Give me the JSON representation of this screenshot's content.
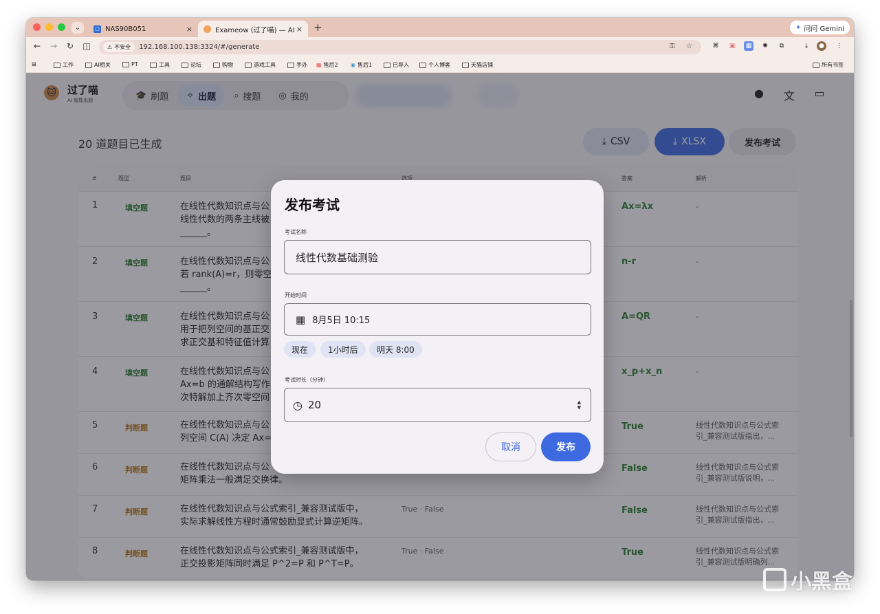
{
  "browser": {
    "tabs": [
      {
        "title": "NAS90B051",
        "close": "×"
      },
      {
        "title": "Exameow (过了喵) — AI Exam",
        "close": "×"
      }
    ],
    "new_tab": "+",
    "gemini_label": "问问 Gemini",
    "insecure_label": "不安全",
    "url": "192.168.100.138:3324/#/generate",
    "bookmarks": [
      "工作",
      "AI相关",
      "PT",
      "工具",
      "论坛",
      "购物",
      "游戏工具",
      "手办",
      "售后2",
      "售后1",
      "已导入",
      "个人博客",
      "天猫店铺"
    ],
    "all_bookmarks": "所有书签"
  },
  "app": {
    "brand_title": "过了喵",
    "brand_subtitle": "AI 智能出题",
    "nav": [
      {
        "icon": "graduation-icon",
        "label": "刷题"
      },
      {
        "icon": "sparkle-icon",
        "label": "出题"
      },
      {
        "icon": "search-icon",
        "label": "搜题"
      },
      {
        "icon": "user-icon",
        "label": "我的"
      }
    ],
    "summary": "20 道题目已生成",
    "btn_csv": "CSV",
    "btn_xlsx": "XLSX",
    "btn_publish": "发布考试"
  },
  "table": {
    "headers": [
      "#",
      "题型",
      "题目",
      "选项",
      "答案",
      "解析"
    ],
    "rows": [
      {
        "num": "1",
        "type": "填空题",
        "kind": "fill",
        "q1": "在线性代数知识点与公",
        "q2": "线性代数的两条主线被",
        "q3": "______。",
        "opt": "",
        "ans": "Ax=λx",
        "exp1": "-",
        "exp2": ""
      },
      {
        "num": "2",
        "type": "填空题",
        "kind": "fill",
        "q1": "在线性代数知识点与公",
        "q2": "若 rank(A)=r，则零空间",
        "q3": "______。",
        "opt": "",
        "ans": "n-r",
        "exp1": "-",
        "exp2": ""
      },
      {
        "num": "3",
        "type": "填空题",
        "kind": "fill",
        "q1": "在线性代数知识点与公",
        "q2": "用于把列空间的基正交",
        "q3": "求正交基和特征值计算",
        "opt": "",
        "ans": "A=QR",
        "exp1": "-",
        "exp2": ""
      },
      {
        "num": "4",
        "type": "填空题",
        "kind": "fill",
        "q1": "在线性代数知识点与公",
        "q2": "Ax=b 的通解结构写作：",
        "q3": "次特解加上齐次零空间",
        "opt": "",
        "ans": "x_p+x_n",
        "exp1": "-",
        "exp2": ""
      },
      {
        "num": "5",
        "type": "判断题",
        "kind": "judge",
        "q1": "在线性代数知识点与公",
        "q2": "列空间 C(A) 决定 Ax=b",
        "q3": "",
        "opt": "",
        "ans": "True",
        "exp1": "线性代数知识点与公式索",
        "exp2": "引_兼容测试版指出，..."
      },
      {
        "num": "6",
        "type": "判断题",
        "kind": "judge",
        "q1": "在线性代数知识点与公",
        "q2": "矩阵乘法一般满足交换律。",
        "q3": "",
        "opt": "",
        "ans": "False",
        "exp1": "线性代数知识点与公式索",
        "exp2": "引_兼容测试版说明，..."
      },
      {
        "num": "7",
        "type": "判断题",
        "kind": "judge",
        "q1": "在线性代数知识点与公式索引_兼容测试版中，",
        "q2": "实际求解线性方程时通常鼓励显式计算逆矩阵。",
        "q3": "",
        "opt": "True · False",
        "ans": "False",
        "exp1": "线性代数知识点与公式索",
        "exp2": "引_兼容测试版指出，..."
      },
      {
        "num": "8",
        "type": "判断题",
        "kind": "judge",
        "q1": "在线性代数知识点与公式索引_兼容测试版中，",
        "q2": "正交投影矩阵同时满足 P^2=P 和 P^T=P。",
        "q3": "",
        "opt": "True · False",
        "ans": "True",
        "exp1": "线性代数知识点与公式索",
        "exp2": "引_兼容测试版明确列..."
      }
    ]
  },
  "modal": {
    "title": "发布考试",
    "name_label": "考试名称",
    "name_value": "线性代数基础测验",
    "start_label": "开始时间",
    "start_value": "8月5日 10:15",
    "chips": [
      "现在",
      "1小时后",
      "明天 8:00"
    ],
    "duration_label": "考试时长（分钟）",
    "duration_value": "20",
    "cancel": "取消",
    "confirm": "发布"
  },
  "watermark": "小黑盒"
}
